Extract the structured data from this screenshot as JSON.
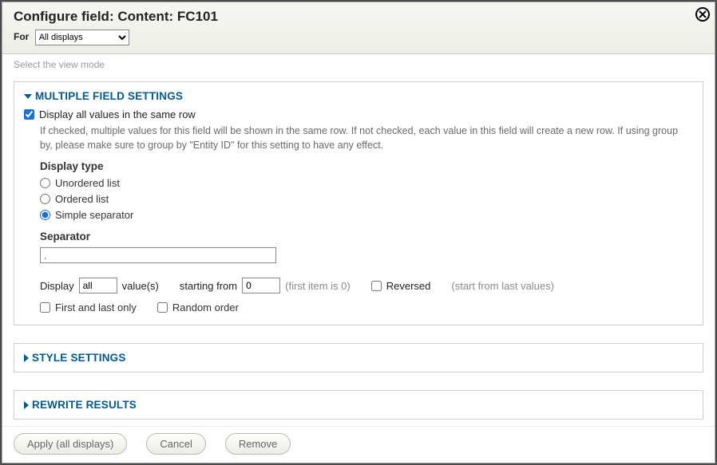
{
  "header": {
    "title": "Configure field: Content: FC101",
    "for_label": "For",
    "for_value": "All displays"
  },
  "top_hint": "Select the view mode",
  "multi": {
    "heading": "MULTIPLE FIELD SETTINGS",
    "checkbox_label": "Display all values in the same row",
    "help": "If checked, multiple values for this field will be shown in the same row. If not checked, each value in this field will create a new row. If using group by, please make sure to group by \"Entity ID\" for this setting to have any effect.",
    "display_type_label": "Display type",
    "radios": {
      "unordered": "Unordered list",
      "ordered": "Ordered list",
      "simple": "Simple separator"
    },
    "separator_label": "Separator",
    "separator_value": ",",
    "row": {
      "display": "Display",
      "all": "all",
      "values": "value(s)",
      "starting": "starting from",
      "start_value": "0",
      "first_hint": "(first item is 0)",
      "reversed": "Reversed",
      "reversed_hint": "(start from last values)"
    },
    "row2": {
      "first_last": "First and last only",
      "random": "Random order"
    }
  },
  "sections": {
    "style": "STYLE SETTINGS",
    "rewrite": "REWRITE RESULTS"
  },
  "footer": {
    "apply": "Apply (all displays)",
    "cancel": "Cancel",
    "remove": "Remove"
  }
}
